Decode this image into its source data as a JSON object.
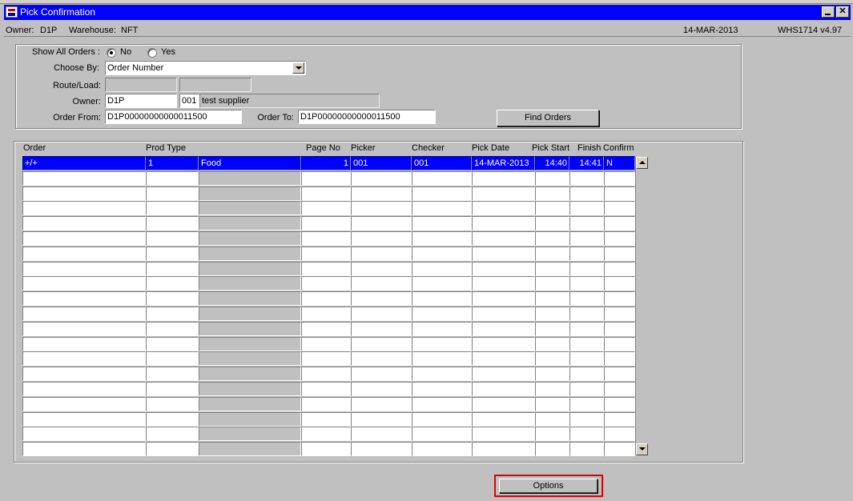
{
  "window": {
    "title": "Pick Confirmation"
  },
  "info": {
    "owner_label": "Owner:",
    "owner_value": "D1P",
    "warehouse_label": "Warehouse:",
    "warehouse_value": "NFT",
    "date": "14-MAR-2013",
    "version": "WHS1714  v4.97"
  },
  "filters": {
    "show_all_label": "Show All Orders :",
    "show_all_no": "No",
    "show_all_yes": "Yes",
    "show_all_selected": "No",
    "choose_by_label": "Choose By:",
    "choose_by_value": "Order Number",
    "route_load_label": "Route/Load:",
    "route_value": "",
    "load_value": "",
    "owner_label": "Owner:",
    "owner_value": "D1P",
    "supplier_code": "001",
    "supplier_name": "test supplier",
    "order_from_label": "Order From:",
    "order_from_value": "D1P00000000000011500",
    "order_to_label": "Order To:",
    "order_to_value": "D1P00000000000011500",
    "find_orders_label": "Find Orders"
  },
  "table": {
    "headers": {
      "order": "Order",
      "prod_type": "Prod Type",
      "page_no": "Page No",
      "picker": "Picker",
      "checker": "Checker",
      "pick_date": "Pick Date",
      "pick_start": "Pick Start",
      "finish": "Finish",
      "confirm": "Confirm"
    },
    "rows": [
      {
        "order": "+/+",
        "prod_type": "1",
        "prod_desc": "Food",
        "page_no": "1",
        "picker": "001",
        "checker": "001",
        "pick_date": "14-MAR-2013",
        "pick_start": "14:40",
        "finish": "14:41",
        "confirm": "N"
      }
    ]
  },
  "footer": {
    "options_label": "Options"
  },
  "colors": {
    "title_bar": "#0000ff",
    "selection": "#0000ff",
    "background": "#c0c0c0",
    "highlight": "#e00000"
  }
}
